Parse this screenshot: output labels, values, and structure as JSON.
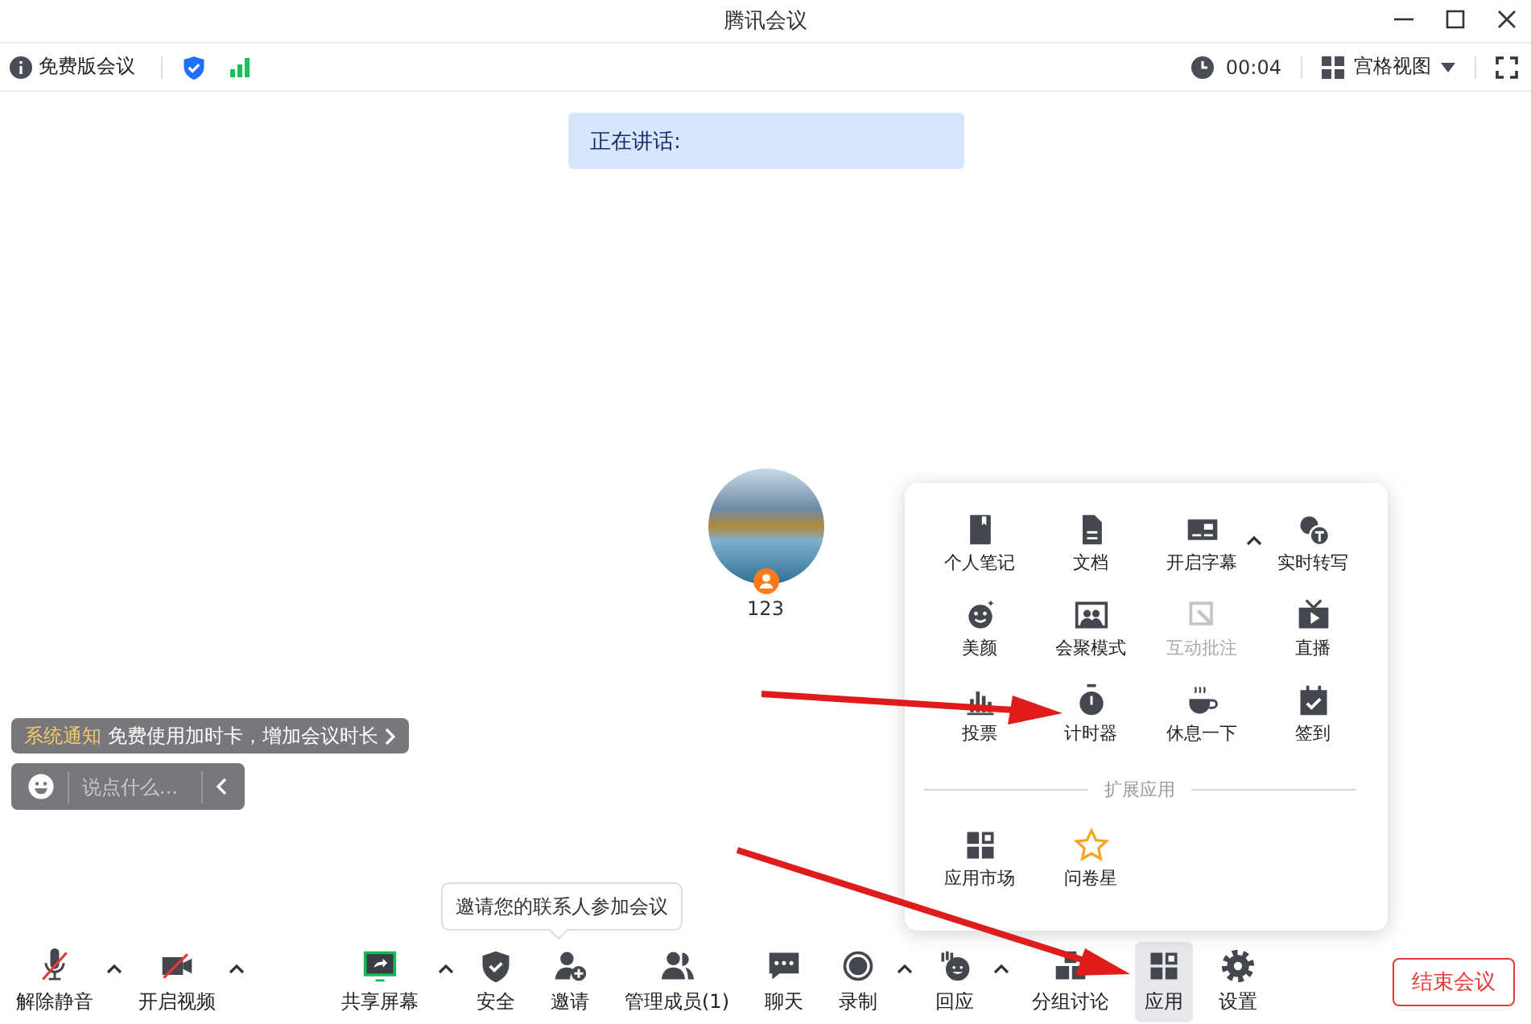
{
  "window": {
    "title": "腾讯会议"
  },
  "info_bar": {
    "edition": "免费版会议",
    "timer": "00:04",
    "view": "宫格视图"
  },
  "speaking_banner": "正在讲话:",
  "participant": {
    "name": "123"
  },
  "notification": {
    "tag": "系统通知",
    "text": "免费使用加时卡，增加会议时长"
  },
  "chat_input": {
    "placeholder": "说点什么..."
  },
  "tooltip": "邀请您的联系人参加会议",
  "apps_panel": {
    "items": [
      {
        "label": "个人笔记",
        "disabled": false,
        "has_menu": false
      },
      {
        "label": "文档",
        "disabled": false,
        "has_menu": false
      },
      {
        "label": "开启字幕",
        "disabled": false,
        "has_menu": true
      },
      {
        "label": "实时转写",
        "disabled": false,
        "has_menu": false
      },
      {
        "label": "美颜",
        "disabled": false,
        "has_menu": false
      },
      {
        "label": "会聚模式",
        "disabled": false,
        "has_menu": false
      },
      {
        "label": "互动批注",
        "disabled": true,
        "has_menu": false
      },
      {
        "label": "直播",
        "disabled": false,
        "has_menu": false
      },
      {
        "label": "投票",
        "disabled": false,
        "has_menu": false
      },
      {
        "label": "计时器",
        "disabled": false,
        "has_menu": false
      },
      {
        "label": "休息一下",
        "disabled": false,
        "has_menu": false
      },
      {
        "label": "签到",
        "disabled": false,
        "has_menu": false
      }
    ],
    "section_title": "扩展应用",
    "extensions": [
      {
        "label": "应用市场"
      },
      {
        "label": "问卷星"
      }
    ]
  },
  "toolbar": {
    "buttons": [
      {
        "label": "解除静音",
        "has_menu": true,
        "selected": false
      },
      {
        "label": "开启视频",
        "has_menu": true,
        "selected": false
      },
      {
        "label": "共享屏幕",
        "has_menu": true,
        "selected": false
      },
      {
        "label": "安全",
        "has_menu": false,
        "selected": false
      },
      {
        "label": "邀请",
        "has_menu": false,
        "selected": false
      },
      {
        "label": "管理成员(1)",
        "has_menu": false,
        "selected": false
      },
      {
        "label": "聊天",
        "has_menu": false,
        "selected": false
      },
      {
        "label": "录制",
        "has_menu": true,
        "selected": false
      },
      {
        "label": "回应",
        "has_menu": true,
        "selected": false
      },
      {
        "label": "分组讨论",
        "has_menu": false,
        "selected": false
      },
      {
        "label": "应用",
        "has_menu": false,
        "selected": true
      },
      {
        "label": "设置",
        "has_menu": false,
        "selected": false
      }
    ],
    "end_button": "结束会议"
  }
}
